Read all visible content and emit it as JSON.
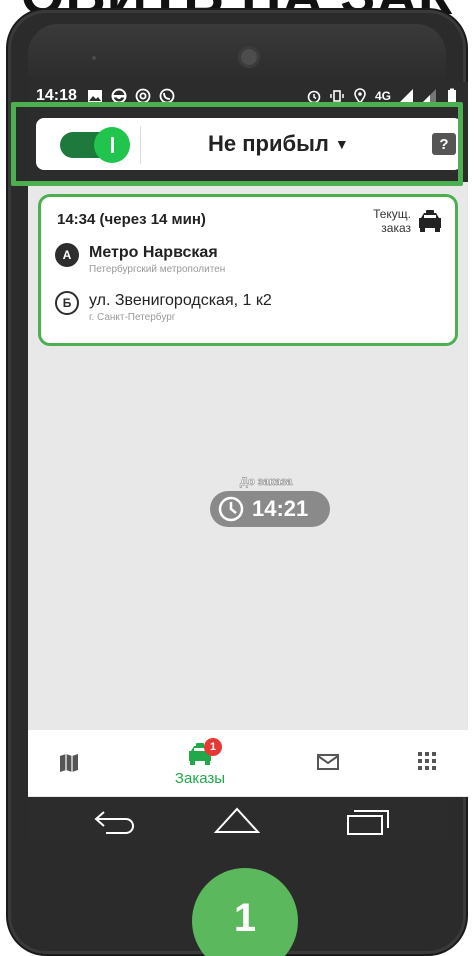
{
  "page_heading": "ОВИТЬ НА ЗАК",
  "status_bar": {
    "time": "14:18",
    "network": "4G"
  },
  "toolbar": {
    "status_label": "Не прибыл",
    "help_label": "?"
  },
  "order": {
    "time_text": "14:34 (через 14 мин)",
    "current_label": "Текущ. заказ",
    "point_a": {
      "marker": "А",
      "title": "Метро Нарвская",
      "subtitle": "Петербургский метрополитен"
    },
    "point_b": {
      "marker": "Б",
      "title": "ул. Звенигородская, 1 к2",
      "subtitle": "г. Санкт-Петербург"
    }
  },
  "countdown": {
    "label": "До заказа",
    "time": "14:21"
  },
  "bottom_nav": {
    "orders_label": "Заказы",
    "orders_badge": "1"
  },
  "step_number": "1",
  "colors": {
    "accent": "#21a84a",
    "highlight": "#4caf50",
    "toggle_on": "#21c44c"
  },
  "icons": [
    "map-icon",
    "taxi-icon",
    "mail-icon",
    "apps-grid-icon",
    "clock-icon",
    "help-icon"
  ]
}
